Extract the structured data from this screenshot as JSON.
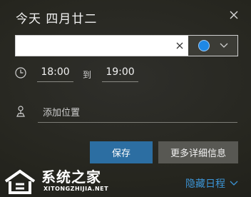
{
  "header": {
    "title": "今天 四月廿二"
  },
  "event": {
    "value": "",
    "placeholder": ""
  },
  "time": {
    "start": "18:00",
    "separator": "到",
    "end": "19:00"
  },
  "location": {
    "placeholder": "添加位置"
  },
  "buttons": {
    "save": "保存",
    "more_details": "更多详细信息"
  },
  "footer": {
    "hide_schedule": "隐藏日程"
  },
  "watermark": {
    "name": "系统之家",
    "url": "XITONGZHIJIA.NET"
  },
  "colors": {
    "accent": "#1e88e5",
    "save_button": "#2c6ea2",
    "link": "#3c95d6"
  },
  "icons": [
    "close-icon",
    "clear-icon",
    "chevron-down-icon",
    "clock-icon",
    "location-icon"
  ]
}
